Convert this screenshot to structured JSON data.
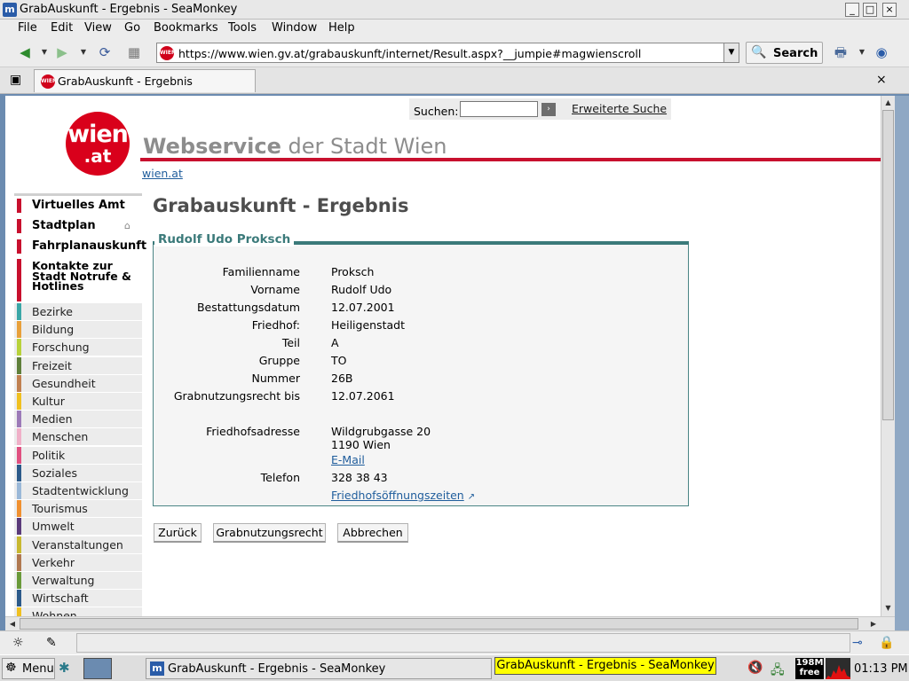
{
  "window": {
    "title": "GrabAuskunft - Ergebnis - SeaMonkey",
    "app_icon": "seamonkey-logo",
    "buttons": [
      "_",
      "□",
      "×"
    ]
  },
  "menubar": {
    "items": [
      "File",
      "Edit",
      "View",
      "Go",
      "Bookmarks",
      "Tools",
      "Window",
      "Help"
    ]
  },
  "navbar": {
    "url": "https://www.wien.gv.at/grabauskunft/internet/Result.aspx?__jumpie#magwienscroll",
    "search_label": "Search",
    "site_icon_text": "WIEN"
  },
  "tabs": {
    "active_label": "GrabAuskunft - Ergebnis",
    "close": "×"
  },
  "site": {
    "search_label": "Suchen:",
    "search_go": "›",
    "extended_search": "Erweiterte Suche",
    "logo_line1": "wien",
    "logo_line2": ".at",
    "brand_bold": "Webservice",
    "brand_rest": "der Stadt Wien",
    "home_link": "wien.at"
  },
  "leftnav": {
    "main": [
      {
        "label": "Virtuelles Amt"
      },
      {
        "label": "Stadtplan"
      },
      {
        "label": "Fahrplanauskunft"
      }
    ],
    "kontakte": "Kontakte zur Stadt Notrufe & Hotlines",
    "categories": [
      {
        "label": "Bezirke",
        "color": "#3aa6a6"
      },
      {
        "label": "Bildung",
        "color": "#e8a03a"
      },
      {
        "label": "Forschung",
        "color": "#b8d23a"
      },
      {
        "label": "Freizeit",
        "color": "#5f7f3a"
      },
      {
        "label": "Gesundheit",
        "color": "#c08050"
      },
      {
        "label": "Kultur",
        "color": "#f0c020"
      },
      {
        "label": "Medien",
        "color": "#9c7ab8"
      },
      {
        "label": "Menschen",
        "color": "#f0b0c8"
      },
      {
        "label": "Politik",
        "color": "#e05080"
      },
      {
        "label": "Soziales",
        "color": "#2c5a8a"
      },
      {
        "label": "Stadtentwicklung",
        "color": "#9ab8d8"
      },
      {
        "label": "Tourismus",
        "color": "#f09030"
      },
      {
        "label": "Umwelt",
        "color": "#5a3a7a"
      },
      {
        "label": "Veranstaltungen",
        "color": "#c8b830"
      },
      {
        "label": "Verkehr",
        "color": "#b07850"
      },
      {
        "label": "Verwaltung",
        "color": "#6a9a3a"
      },
      {
        "label": "Wirtschaft",
        "color": "#2c5a8a"
      },
      {
        "label": "Wohnen",
        "color": "#f0c020"
      }
    ]
  },
  "result": {
    "page_title": "Grabauskunft - Ergebnis",
    "person": "Rudolf Udo Proksch",
    "fields": [
      {
        "label": "Familienname",
        "value": "Proksch"
      },
      {
        "label": "Vorname",
        "value": "Rudolf Udo"
      },
      {
        "label": "Bestattungsdatum",
        "value": "12.07.2001"
      },
      {
        "label": "Friedhof:",
        "value": "Heiligenstadt"
      },
      {
        "label": "Teil",
        "value": "A"
      },
      {
        "label": "Gruppe",
        "value": "TO"
      },
      {
        "label": "Nummer",
        "value": "26B"
      },
      {
        "label": "Grabnutzungsrecht bis",
        "value": "12.07.2061"
      }
    ],
    "address_label": "Friedhofsadresse",
    "address_line1": "Wildgrubgasse 20",
    "address_line2": "1190 Wien",
    "email_link": "E-Mail",
    "phone_label": "Telefon",
    "phone_value": "328 38 43",
    "hours_link": "Friedhofsöffnungszeiten"
  },
  "buttons": {
    "back": "Zurück",
    "right": "Grabnutzungsrecht",
    "cancel": "Abbrechen"
  },
  "taskbar": {
    "menu_label": "Menu",
    "task_label": "GrabAuskunft - Ergebnis - SeaMonkey",
    "tooltip": "GrabAuskunft - Ergebnis - SeaMonkey",
    "memory_line1": "198M",
    "memory_line2": "free",
    "clock": "01:13 PM"
  }
}
